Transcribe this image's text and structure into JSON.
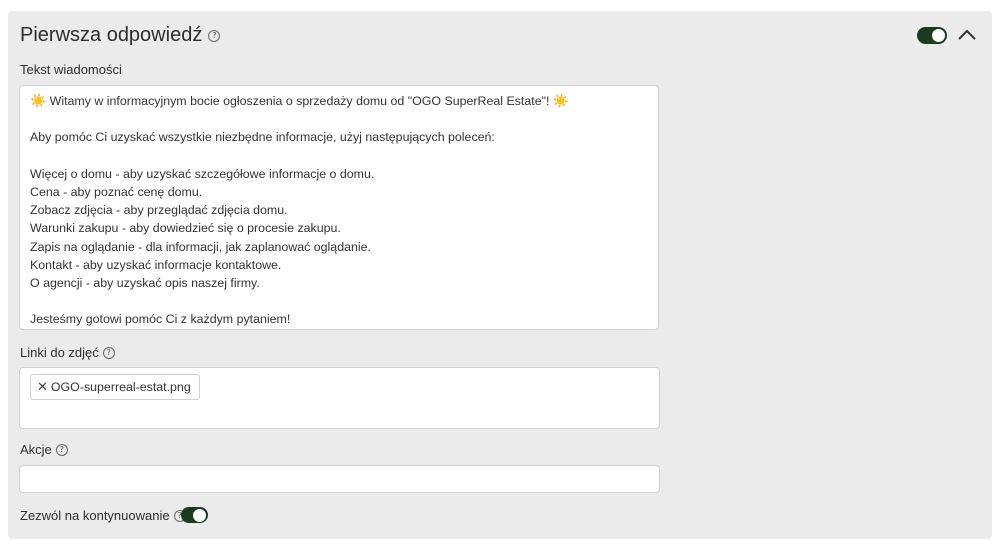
{
  "section": {
    "title": "Pierwsza odpowiedź",
    "help_icon": "?",
    "enabled": true
  },
  "message": {
    "label": "Tekst wiadomości",
    "lines": [
      {
        "pre": "☀️",
        "text": " Witamy w informacyjnym bocie ogłoszenia o sprzedaży domu od \"OGO SuperReal Estate\"! ",
        "post": "☀️"
      },
      {
        "text": ""
      },
      {
        "text": "Aby pomóc Ci uzyskać wszystkie niezbędne informacje, użyj następujących poleceń:"
      },
      {
        "text": ""
      },
      {
        "text": "Więcej o domu - aby uzyskać szczegółowe informacje o domu."
      },
      {
        "text": "Cena - aby poznać cenę domu."
      },
      {
        "text": "Zobacz zdjęcia - aby przeglądać zdjęcia domu."
      },
      {
        "text": "Warunki zakupu - aby dowiedzieć się o procesie zakupu."
      },
      {
        "text": "Zapis na oglądanie - dla informacji, jak zaplanować oglądanie."
      },
      {
        "text": "Kontakt - aby uzyskać informacje kontaktowe."
      },
      {
        "text": "O agencji - aby uzyskać opis naszej firmy."
      },
      {
        "text": ""
      },
      {
        "text": "Jesteśmy gotowi pomóc Ci z każdym pytaniem!"
      }
    ]
  },
  "photos": {
    "label": "Linki do zdjęć",
    "tags": [
      "OGO-superreal-estat.png"
    ]
  },
  "actions": {
    "label": "Akcje",
    "value": ""
  },
  "continue": {
    "label": "Zezwól na kontynuowanie",
    "enabled": true
  },
  "colors": {
    "panel_bg": "#eaebea",
    "toggle_on": "#1a3b1e",
    "border": "#cfd2cf"
  }
}
